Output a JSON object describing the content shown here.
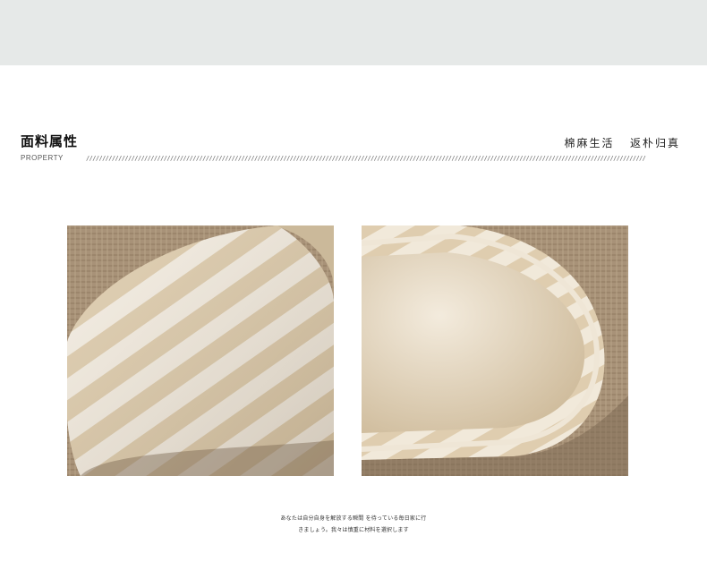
{
  "header": {
    "title": "面料属性",
    "subtitle": "PROPERTY",
    "slogan": "棉麻生活   返朴归真",
    "slash_pattern": "/////////////////////////////////////////////////////////////////////////////////////////////////////////////////////////////////////////////////////////////////////////////"
  },
  "photos": [
    {
      "id": "toe"
    },
    {
      "id": "insole"
    }
  ],
  "caption": {
    "line1": "あなたは自分自身を解放する瞬間 を待っている毎日家に行",
    "line2": "きましょう。我々は慎重に材料を選択します"
  },
  "colors": {
    "top_band": "#e6e9e8",
    "burlap": "#a89278",
    "fabric_light": "#f3ece0",
    "fabric_stripe": "#dcc9a8"
  }
}
